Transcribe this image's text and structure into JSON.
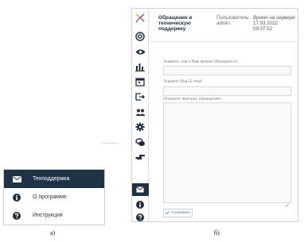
{
  "panel_a": {
    "caption": "а)",
    "menu": [
      {
        "label": "Техподдержка",
        "icon": "envelope-icon",
        "active": true
      },
      {
        "label": "О программе",
        "icon": "info-icon",
        "active": false
      },
      {
        "label": "Инструкция",
        "icon": "help-icon",
        "active": false
      }
    ]
  },
  "panel_b": {
    "caption": "б)",
    "header": {
      "title": "Обращение в техническую поддержку",
      "user_label": "Пользователь:",
      "user": "admin",
      "time_label": "Время на сервере:",
      "date": "17.03.2022",
      "time": "09:37:52"
    },
    "form": {
      "name_label": "Укажите, как к Вам можно обращаться:",
      "name_value": "",
      "email_label": "Укажите Ваш E-mail:",
      "email_value": "",
      "reason_label": "Опишите причину обращения:",
      "reason_value": "",
      "save_label": "Сохранить"
    },
    "sidebar_icons": [
      "logo-icon",
      "target-icon",
      "eye-icon",
      "bar-chart-icon",
      "calendar-icon",
      "exit-icon",
      "users-icon",
      "gear-icon",
      "coins-icon",
      "hand-icon",
      "envelope-icon",
      "info-icon",
      "help-icon"
    ]
  },
  "colors": {
    "active_bg": "#1f3347",
    "accent": "#3c6fb6"
  }
}
